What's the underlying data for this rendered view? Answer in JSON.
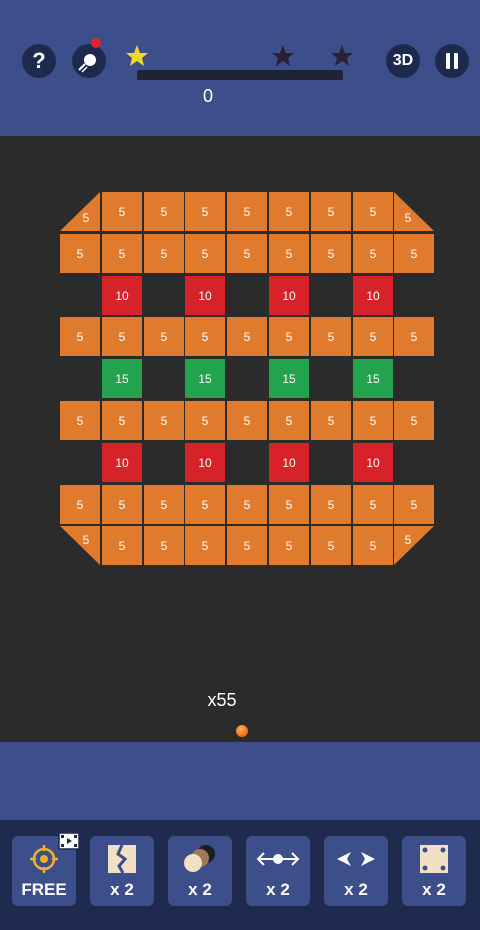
{
  "top": {
    "help_label": "?",
    "view_label": "3D",
    "score": "0",
    "stars_earned": 1,
    "stars_total": 3
  },
  "field": {
    "ball_count": "x55",
    "colors": {
      "orange": "#e07a2c",
      "red": "#d72229",
      "green": "#23a34e"
    },
    "rows": [
      [
        [
          "5",
          "o"
        ],
        [
          "5",
          "o"
        ],
        [
          "5",
          "o"
        ],
        [
          "5",
          "o"
        ],
        [
          "5",
          "o"
        ],
        [
          "5",
          "o"
        ],
        [
          "5",
          "o"
        ],
        [
          "5",
          "o"
        ],
        [
          "5",
          "o"
        ]
      ],
      [
        [
          "5",
          "o"
        ],
        [
          "5",
          "o"
        ],
        [
          "5",
          "o"
        ],
        [
          "5",
          "o"
        ],
        [
          "5",
          "o"
        ],
        [
          "5",
          "o"
        ],
        [
          "5",
          "o"
        ],
        [
          "5",
          "o"
        ],
        [
          "5",
          "o"
        ]
      ],
      [
        null,
        [
          "10",
          "r"
        ],
        null,
        [
          "10",
          "r"
        ],
        null,
        [
          "10",
          "r"
        ],
        null,
        [
          "10",
          "r"
        ],
        null
      ],
      [
        [
          "5",
          "o"
        ],
        [
          "5",
          "o"
        ],
        [
          "5",
          "o"
        ],
        [
          "5",
          "o"
        ],
        [
          "5",
          "o"
        ],
        [
          "5",
          "o"
        ],
        [
          "5",
          "o"
        ],
        [
          "5",
          "o"
        ],
        [
          "5",
          "o"
        ]
      ],
      [
        null,
        [
          "15",
          "g"
        ],
        null,
        [
          "15",
          "g"
        ],
        null,
        [
          "15",
          "g"
        ],
        null,
        [
          "15",
          "g"
        ],
        null
      ],
      [
        [
          "5",
          "o"
        ],
        [
          "5",
          "o"
        ],
        [
          "5",
          "o"
        ],
        [
          "5",
          "o"
        ],
        [
          "5",
          "o"
        ],
        [
          "5",
          "o"
        ],
        [
          "5",
          "o"
        ],
        [
          "5",
          "o"
        ],
        [
          "5",
          "o"
        ]
      ],
      [
        null,
        [
          "10",
          "r"
        ],
        null,
        [
          "10",
          "r"
        ],
        null,
        [
          "10",
          "r"
        ],
        null,
        [
          "10",
          "r"
        ],
        null
      ],
      [
        [
          "5",
          "o"
        ],
        [
          "5",
          "o"
        ],
        [
          "5",
          "o"
        ],
        [
          "5",
          "o"
        ],
        [
          "5",
          "o"
        ],
        [
          "5",
          "o"
        ],
        [
          "5",
          "o"
        ],
        [
          "5",
          "o"
        ],
        [
          "5",
          "o"
        ]
      ],
      [
        [
          "5",
          "o"
        ],
        [
          "5",
          "o"
        ],
        [
          "5",
          "o"
        ],
        [
          "5",
          "o"
        ],
        [
          "5",
          "o"
        ],
        [
          "5",
          "o"
        ],
        [
          "5",
          "o"
        ],
        [
          "5",
          "o"
        ],
        [
          "5",
          "o"
        ]
      ]
    ]
  },
  "powerups": {
    "free": "FREE",
    "split": "x 2",
    "multiball": "x 2",
    "wide": "x 2",
    "narrow": "x 2",
    "dots": "x 2"
  }
}
